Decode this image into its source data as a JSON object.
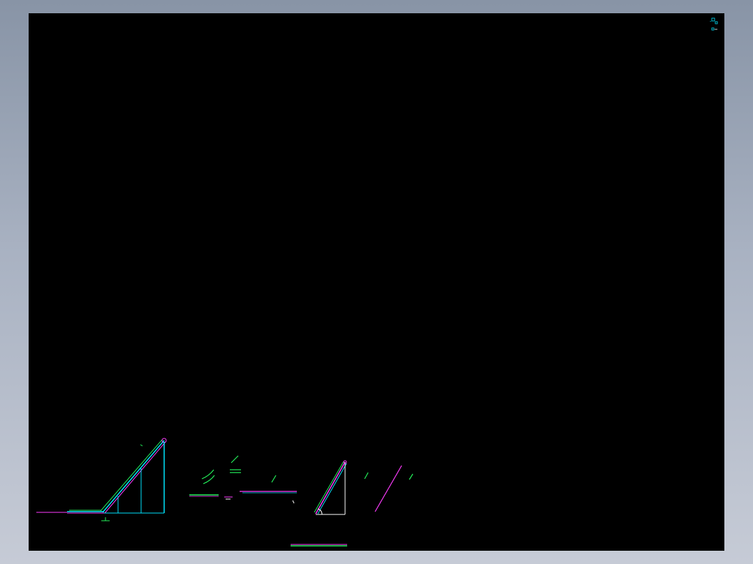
{
  "viewer": {
    "background_color": "#000000",
    "frame_color": "#9aa3b3"
  },
  "colors": {
    "cyan": "#00e5ff",
    "magenta": "#ff3cff",
    "green": "#23f05a",
    "white": "#ffffff",
    "yellow": "#ffff00",
    "light_green": "#7cff7c"
  },
  "icons": {
    "view_cube": "view-cube-icon"
  }
}
